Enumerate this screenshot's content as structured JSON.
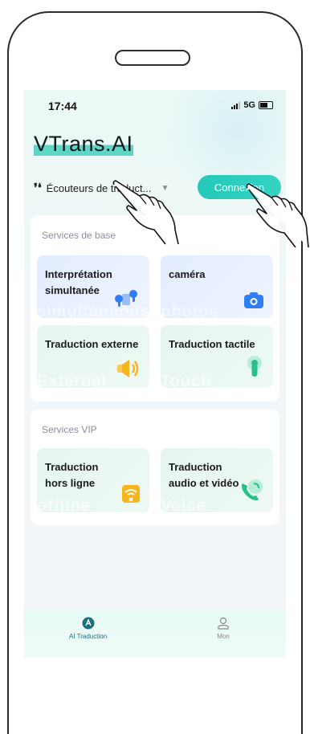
{
  "status_bar": {
    "time": "17:44",
    "network": "5G"
  },
  "app": {
    "title": "VTrans.AI"
  },
  "device": {
    "name": "Écouteurs de traduct..."
  },
  "login": {
    "label": "Connexion"
  },
  "basic_services": {
    "title": "Services de base",
    "tiles": [
      {
        "label": "Interprétation simultanée",
        "watermark": "simultaneous",
        "icon": "earbuds-icon"
      },
      {
        "label": "caméra",
        "watermark": "photos",
        "icon": "camera-icon"
      },
      {
        "label": "Traduction externe",
        "watermark": "External",
        "icon": "speaker-icon"
      },
      {
        "label": "Traduction tactile",
        "watermark": "Touch",
        "icon": "touch-icon"
      }
    ]
  },
  "vip_services": {
    "title": "Services VIP",
    "tiles": [
      {
        "label": "Traduction hors ligne",
        "watermark": "offline",
        "icon": "offline-wifi-icon"
      },
      {
        "label": "Traduction audio et vidéo",
        "watermark": "Voice",
        "icon": "phone-call-icon"
      }
    ]
  },
  "tabbar": {
    "tabs": [
      {
        "label": "AI Traduction",
        "active": true
      },
      {
        "label": "Mon",
        "active": false
      }
    ]
  },
  "colors": {
    "accent": "#2ccbbb",
    "blue_icon": "#2f7ef5",
    "orange_icon": "#f5b521",
    "green_icon": "#26c08a"
  }
}
